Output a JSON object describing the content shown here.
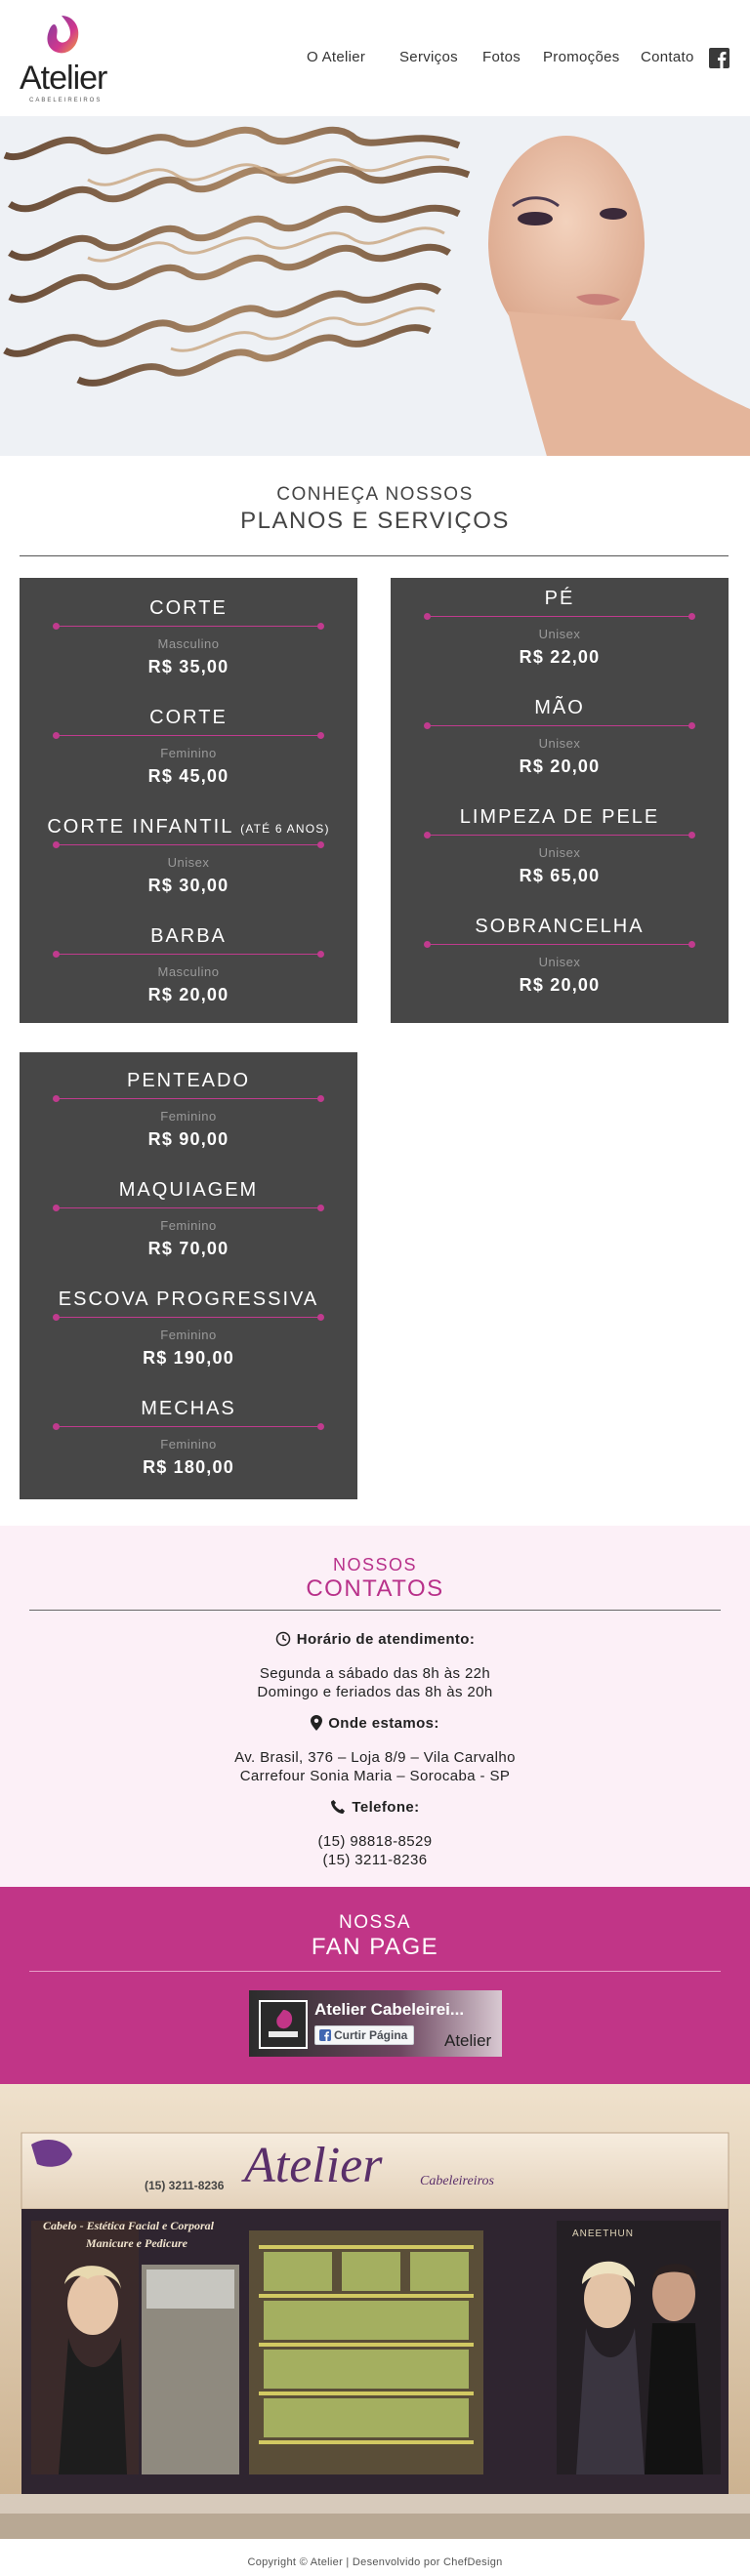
{
  "header": {
    "logo_text": "Atelier",
    "logo_subtext": "CABELEIREIROS",
    "nav": [
      {
        "label": "O Atelier"
      },
      {
        "label": "Serviços"
      },
      {
        "label": "Fotos"
      },
      {
        "label": "Promoções"
      },
      {
        "label": "Contato"
      }
    ],
    "facebook_icon": "facebook-icon"
  },
  "services": {
    "kicker": "CONHEÇA NOSSOS",
    "title": "PLANOS E SERVIÇOS",
    "cards": [
      {
        "items": [
          {
            "name": "CORTE",
            "category": "Masculino",
            "price": "R$ 35,00"
          },
          {
            "name": "CORTE",
            "category": "Feminino",
            "price": "R$ 45,00"
          },
          {
            "name": "CORTE INFANTIL",
            "note": "(ATÉ 6 ANOS)",
            "category": "Unisex",
            "price": "R$ 30,00"
          },
          {
            "name": "BARBA",
            "category": "Masculino",
            "price": "R$ 20,00"
          }
        ]
      },
      {
        "items": [
          {
            "name": "PÉ",
            "category": "Unisex",
            "price": "R$ 22,00"
          },
          {
            "name": "MÃO",
            "category": "Unisex",
            "price": "R$ 20,00"
          },
          {
            "name": "LIMPEZA DE PELE",
            "category": "Unisex",
            "price": "R$ 65,00"
          },
          {
            "name": "SOBRANCELHA",
            "category": "Unisex",
            "price": "R$ 20,00"
          }
        ]
      },
      {
        "items": [
          {
            "name": "PENTEADO",
            "category": "Feminino",
            "price": "R$ 90,00"
          },
          {
            "name": "MAQUIAGEM",
            "category": "Feminino",
            "price": "R$ 70,00"
          },
          {
            "name": "ESCOVA PROGRESSIVA",
            "category": "Feminino",
            "price": "R$ 190,00"
          },
          {
            "name": "MECHAS",
            "category": "Feminino",
            "price": "R$ 180,00"
          }
        ]
      }
    ]
  },
  "contacts": {
    "kicker": "NOSSOS",
    "title": "CONTATOS",
    "hours_label": "Horário de atendimento:",
    "hours_lines": [
      "Segunda a sábado das 8h às 22h",
      "Domingo e feriados das 8h às 20h"
    ],
    "address_label": "Onde estamos:",
    "address_lines": [
      "Av. Brasil, 376 – Loja 8/9 – Vila Carvalho",
      "Carrefour Sonia Maria – Sorocaba - SP"
    ],
    "phone_label": "Telefone:",
    "phones": [
      "(15) 98818-8529",
      "(15) 3211-8236"
    ]
  },
  "fanpage": {
    "kicker": "NOSSA",
    "title": "FAN PAGE",
    "page_name": "Atelier Cabeleirei...",
    "like_button": "Curtir Página",
    "widget_logo": "Atelier"
  },
  "storefront": {
    "sign": "Atelier",
    "sign_sub": "Cabeleireiros",
    "phone": "(15) 3211-8236",
    "tagline_1": "Cabelo - Estética Facial e Corporal",
    "tagline_2": "Manicure e Pedicure",
    "brand_right": "ANEETHUN"
  },
  "footer": {
    "text": "Copyright © Atelier | Desenvolvido por ChefDesign"
  },
  "colors": {
    "accent": "#c13587",
    "card_bg": "#474747",
    "contacts_bg": "#fcf0f7"
  }
}
